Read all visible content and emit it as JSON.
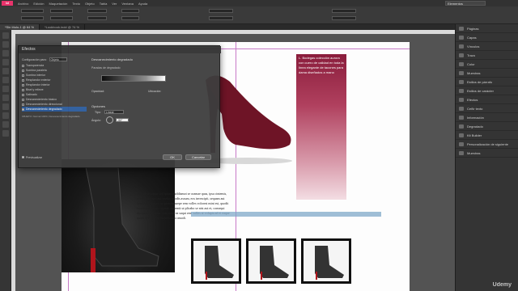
{
  "app": {
    "logo": "Id"
  },
  "menu": [
    "Archivo",
    "Edición",
    "Maquetación",
    "Texto",
    "Objeto",
    "Tabla",
    "Ver",
    "Ventana",
    "Ayuda"
  ],
  "workspace": "Elementos",
  "doc_tabs": [
    {
      "label": "*Sin título-1 @ 64 %",
      "active": true
    },
    {
      "label": "*Lookbook.indd @ 74 %",
      "active": false
    }
  ],
  "dialog": {
    "title": "Efectos",
    "config_label": "Configuración para:",
    "config_value": "Objeto",
    "items": [
      {
        "label": "Transparencia",
        "checked": false,
        "selected": false
      },
      {
        "label": "Sombra paralela",
        "checked": false,
        "selected": false
      },
      {
        "label": "Sombra interior",
        "checked": false,
        "selected": false
      },
      {
        "label": "Resplandor exterior",
        "checked": false,
        "selected": false
      },
      {
        "label": "Resplandor interior",
        "checked": false,
        "selected": false
      },
      {
        "label": "Bisel y relieve",
        "checked": false,
        "selected": false
      },
      {
        "label": "Satinado",
        "checked": false,
        "selected": false
      },
      {
        "label": "Desvanecimiento básico",
        "checked": false,
        "selected": false
      },
      {
        "label": "Desvanecimiento direccional",
        "checked": false,
        "selected": false
      },
      {
        "label": "Desvanecimiento degradado",
        "checked": true,
        "selected": true
      }
    ],
    "summary": "OBJETO: Normal 100%; Desvanecimiento degradado",
    "section_title": "Desvanecimiento degradado",
    "stops_label": "Paradas de degradado",
    "opacity_label": "Opacidad:",
    "location_label": "Ubicación:",
    "options_label": "Opciones",
    "type_label": "Tipo:",
    "type_value": "Lineal",
    "angle_label": "Ángulo:",
    "angle_value": "-90°",
    "preview_label": "Previsualizar",
    "ok_label": "OK",
    "cancel_label": "Cancelar"
  },
  "canvas": {
    "pink_text": "L. Bodegas colección aurora con cuero de calidad en toda la línea elegante de tacones para dama diseñados a mano",
    "body_text": "dunt in se ruptur sed ipsum moldiamot se oramae quas, ipsa cintemis, suscius dolupta aut unelus quodis assum, eos invescipit, sequam aut hendlis quibusam ne pernatu saepe rem volles volorest mint est, quodit lamentum laccus cuptum aspiemit ut plicabo se nist aut et, consequi ducipsant se venis, cum imus ea suqui rem volles at volupta ad et eaque quam del ipsum plisapersonist omodi."
  },
  "panels": [
    {
      "label": "Páginas",
      "icon": "pages-icon"
    },
    {
      "label": "Capas",
      "icon": "layers-icon"
    },
    {
      "label": "Vínculos",
      "icon": "links-icon"
    },
    {
      "label": "Trazo",
      "icon": "stroke-icon"
    },
    {
      "label": "Color",
      "icon": "color-icon"
    },
    {
      "label": "Muestras",
      "icon": "swatches-icon"
    },
    {
      "label": "Estilos de párrafo",
      "icon": "paragraph-styles-icon"
    },
    {
      "label": "Estilos de carácter",
      "icon": "character-styles-icon"
    },
    {
      "label": "Efectos",
      "icon": "effects-icon"
    },
    {
      "label": "Ceñir texto",
      "icon": "text-wrap-icon"
    },
    {
      "label": "Información",
      "icon": "info-icon"
    },
    {
      "label": "Degradado",
      "icon": "gradient-icon"
    },
    {
      "label": "Kit Builder",
      "icon": "kit-icon"
    },
    {
      "label": "Personalización de siguiente",
      "icon": "custom-icon"
    },
    {
      "label": "Muestras",
      "icon": "swatches-icon"
    }
  ],
  "watermark": "Udemy"
}
